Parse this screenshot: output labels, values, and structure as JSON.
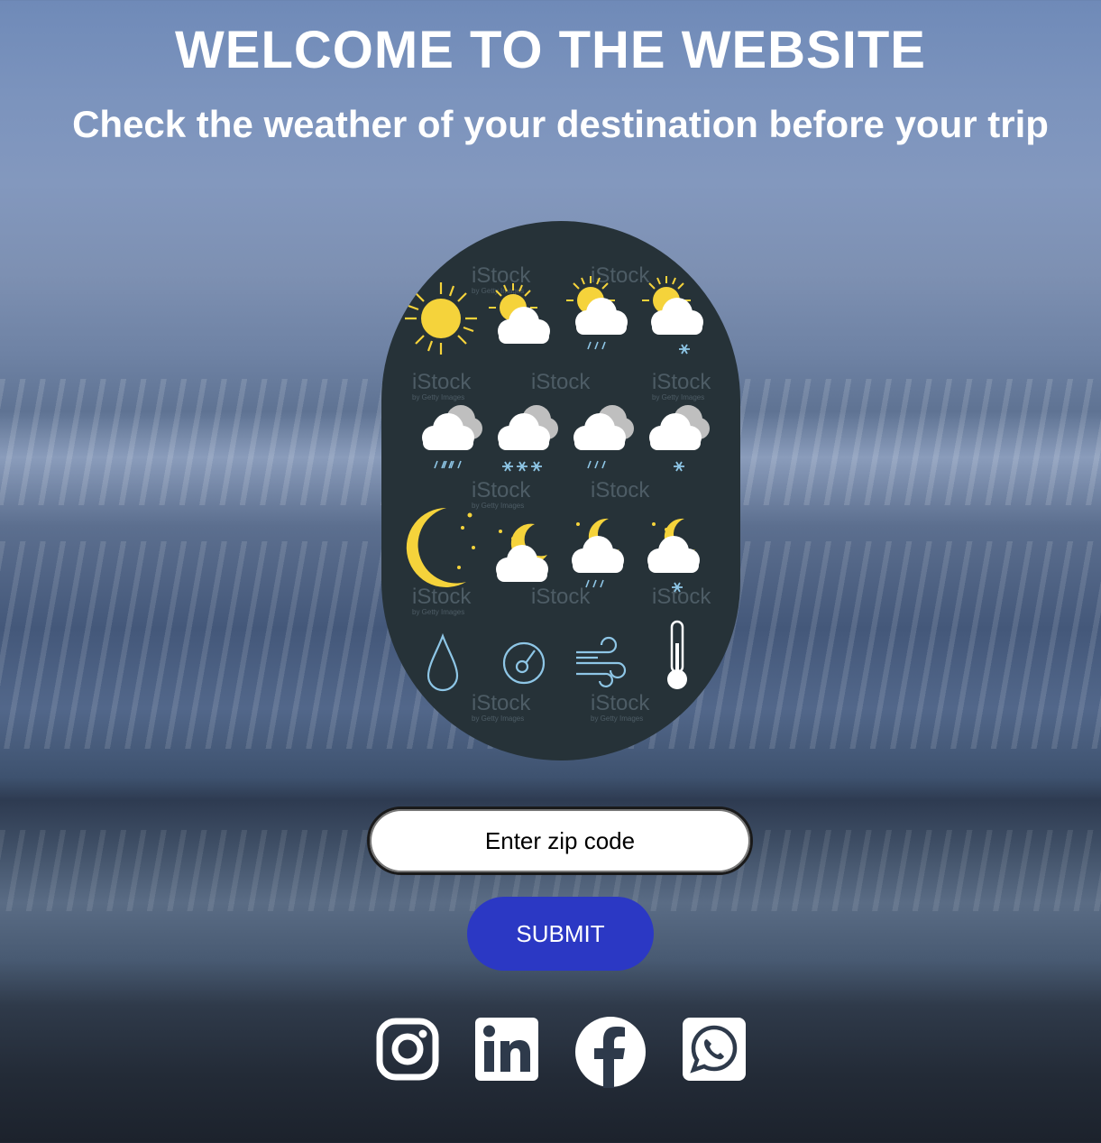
{
  "header": {
    "title": "WELCOME TO THE WEBSITE",
    "subtitle": "Check the weather of your destination before your trip"
  },
  "weather_image": {
    "watermark": "iStock",
    "watermark_sub": "by Getty Images",
    "icons": [
      "sun-icon",
      "partly-cloudy-icon",
      "sun-rain-icon",
      "sun-snow-icon",
      "cloud-rain-icon",
      "cloud-snow-icon",
      "cloud-light-rain-icon",
      "cloud-light-snow-icon",
      "moon-icon",
      "moon-cloud-icon",
      "moon-rain-icon",
      "moon-snow-icon",
      "humidity-icon",
      "pressure-icon",
      "wind-icon",
      "thermometer-icon"
    ]
  },
  "form": {
    "zip_placeholder": "Enter zip code",
    "submit_label": "SUBMIT"
  },
  "social": [
    "instagram-icon",
    "linkedin-icon",
    "facebook-icon",
    "whatsapp-icon"
  ],
  "colors": {
    "panel": "#263238",
    "sun": "#f5d33b",
    "submit": "#2b38c4",
    "icon_outline": "#8ec6e6"
  }
}
